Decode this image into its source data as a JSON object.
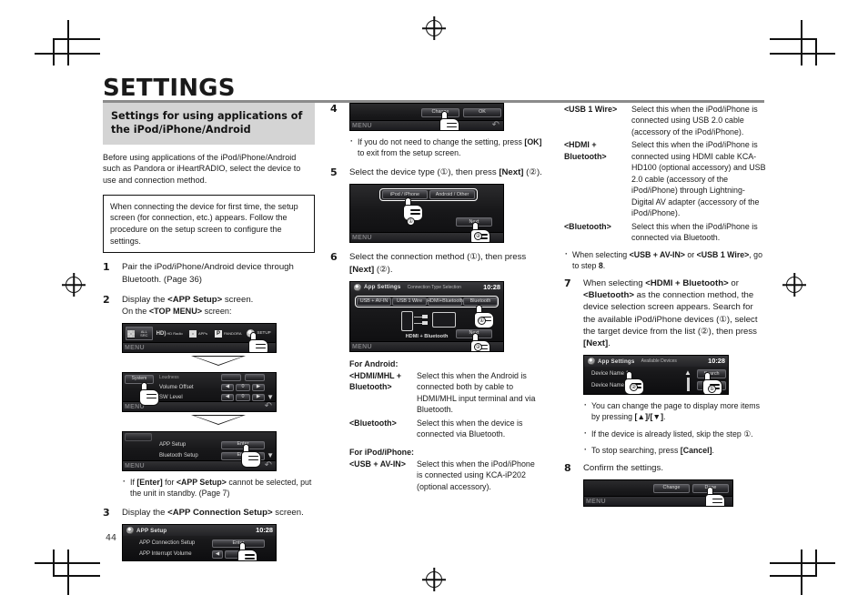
{
  "page": {
    "chapter_title": "SETTINGS",
    "page_number": "44"
  },
  "section": {
    "heading": "Settings for using applications of the iPod/iPhone/Android",
    "intro": "Before using applications of the iPod/iPhone/Android such as Pandora or iHeartRADIO, select the device to use and connection method.",
    "notebox": "When connecting the device for first time, the setup screen (for connection, etc.) appears. Follow the procedure on the setup screen to configure the settings."
  },
  "steps": {
    "s1": {
      "num": "1",
      "text_a": "Pair the iPod/iPhone/Android device",
      "text_b": "through Bluetooth. (Page 36)"
    },
    "s2": {
      "num": "2",
      "text_a": "Display the ",
      "bold_a": "<APP Setup>",
      "text_b": " screen.",
      "sub_a": "On the ",
      "sub_bold": "<TOP MENU>",
      "sub_b": " screen:",
      "bullet": "If [Enter] for <APP Setup> cannot be selected, put the unit in standby. (Page 7)",
      "bullet_b1": "If ",
      "bullet_b2": "[Enter]",
      "bullet_b3": " for ",
      "bullet_b4": "<APP Setup>",
      "bullet_b5": " cannot be selected, put the unit in standby. (Page 7)"
    },
    "s3": {
      "num": "3",
      "text_a": "Display the ",
      "bold_a": "<APP Connection Setup>",
      "text_b": " screen."
    },
    "s4": {
      "num": "4",
      "bullet_1": "If you do not need to change the setting, press ",
      "bullet_bold": "[OK]",
      "bullet_2": " to exit from the setup screen."
    },
    "s5": {
      "num": "5",
      "text_a": "Select the device type (①), then press ",
      "bold_a": "[Next]",
      "text_b": " (②)."
    },
    "s6": {
      "num": "6",
      "text_a": "Select the connection method (①), then press ",
      "bold_a": "[Next]",
      "text_b": " (②).",
      "group_android": "For Android:",
      "group_ipod": "For iPod/iPhone:",
      "defs_android": [
        {
          "term": "<HDMI/MHL + Bluetooth>",
          "desc": "Select this when the Android is connected both by cable to HDMI/MHL input terminal and via Bluetooth."
        },
        {
          "term": "<Bluetooth>",
          "desc": "Select this when the device is connected via Bluetooth."
        }
      ],
      "defs_ipod_col2": [
        {
          "term": "<USB + AV-IN>",
          "desc": "Select this when the iPod/iPhone is connected using KCA-iP202 (optional accessory)."
        }
      ],
      "defs_ipod_col3": [
        {
          "term": "<USB 1 Wire>",
          "desc": "Select this when the iPod/iPhone is connected using USB 2.0 cable (accessory of the iPod/iPhone)."
        },
        {
          "term": "<HDMI + Bluetooth>",
          "desc": "Select this when the iPod/iPhone is connected using HDMI cable KCA-HD100 (optional accessory) and USB 2.0 cable (accessory of the iPod/iPhone) through Lightning-Digital AV adapter (accessory of the iPod/iPhone)."
        },
        {
          "term": "<Bluetooth>",
          "desc": "Select this when the iPod/iPhone is connected via Bluetooth."
        }
      ],
      "bullet_after": "When selecting <USB + AV-IN> or <USB 1 Wire>, go to step 8.",
      "bullet_after_p1": "When selecting ",
      "bullet_after_b1": "<USB + AV-IN>",
      "bullet_after_p2": " or ",
      "bullet_after_b2": "<USB 1 Wire>",
      "bullet_after_p3": ", go to step ",
      "bullet_after_b3": "8",
      "bullet_after_p4": "."
    },
    "s7": {
      "num": "7",
      "p1": "When selecting ",
      "b1": "<HDMI + Bluetooth>",
      "p2": " or ",
      "b2": "<Bluetooth>",
      "p3": " as the connection method, the device selection screen appears. Search for the available iPod/iPhone devices (①), select the target device from the list (②), then press ",
      "b3": "[Next]",
      "p4": ".",
      "bullets": [
        "You can change the page to display more items by pressing [▲]/[▼].",
        "If the device is already listed, skip the step ①.",
        "To stop searching, press [Cancel]."
      ],
      "bullet1_p1": "You can change the page to display more items by pressing ",
      "bullet1_b": "[▲]/[▼]",
      "bullet1_p2": ".",
      "bullet2_p1": "If the device is already listed, skip the step ①.",
      "bullet3_p1": "To stop searching, press ",
      "bullet3_b": "[Cancel]",
      "bullet3_p2": "."
    },
    "s8": {
      "num": "8",
      "text": "Confirm the settings."
    }
  },
  "screens": {
    "top_menu": {
      "items": [
        "ALL SRC",
        "HD Radio",
        "APPs",
        "PANDORA",
        "SETUP"
      ],
      "menu_label": "MENU"
    },
    "system_setup": {
      "tab": "System",
      "rows": [
        "Loudness",
        "Volume Offset",
        "SW Level"
      ],
      "values": [
        "0",
        "0"
      ],
      "menu_label": "MENU"
    },
    "app_setup_menu": {
      "rows": [
        "APP Setup",
        "Bluetooth Setup"
      ],
      "button": "Enter",
      "menu_label": "MENU"
    },
    "app_setup": {
      "title": "APP Setup",
      "clock": "10:28",
      "rows": [
        "APP Connection Setup",
        "APP Interrupt Volume"
      ],
      "button": "Enter"
    },
    "change_ok": {
      "btn_change": "Change",
      "btn_ok": "OK",
      "menu_label": "MENU"
    },
    "device_type": {
      "btn_left": "iPod / iPhone",
      "btn_right": "Android / Other",
      "btn_next": "Next",
      "menu_label": "MENU"
    },
    "connection_type": {
      "title": "App Settings",
      "subtitle": "Connection Type Selection",
      "clock": "10:28",
      "tabs": [
        "USB + AV-IN",
        "USB 1 Wire",
        "HDMI+Bluetooth",
        "Bluetooth"
      ],
      "caption": "HDMI + Bluetooth",
      "btn_next": "Next",
      "menu_label": "MENU"
    },
    "available_devices": {
      "title": "App Settings",
      "subtitle": "Available Devices",
      "clock": "10:28",
      "rows": [
        "Device Name 1",
        "Device Name 2"
      ],
      "btn_search": "Search"
    },
    "confirm": {
      "btn_change": "Change",
      "btn_done": "Done",
      "menu_label": "MENU"
    }
  }
}
